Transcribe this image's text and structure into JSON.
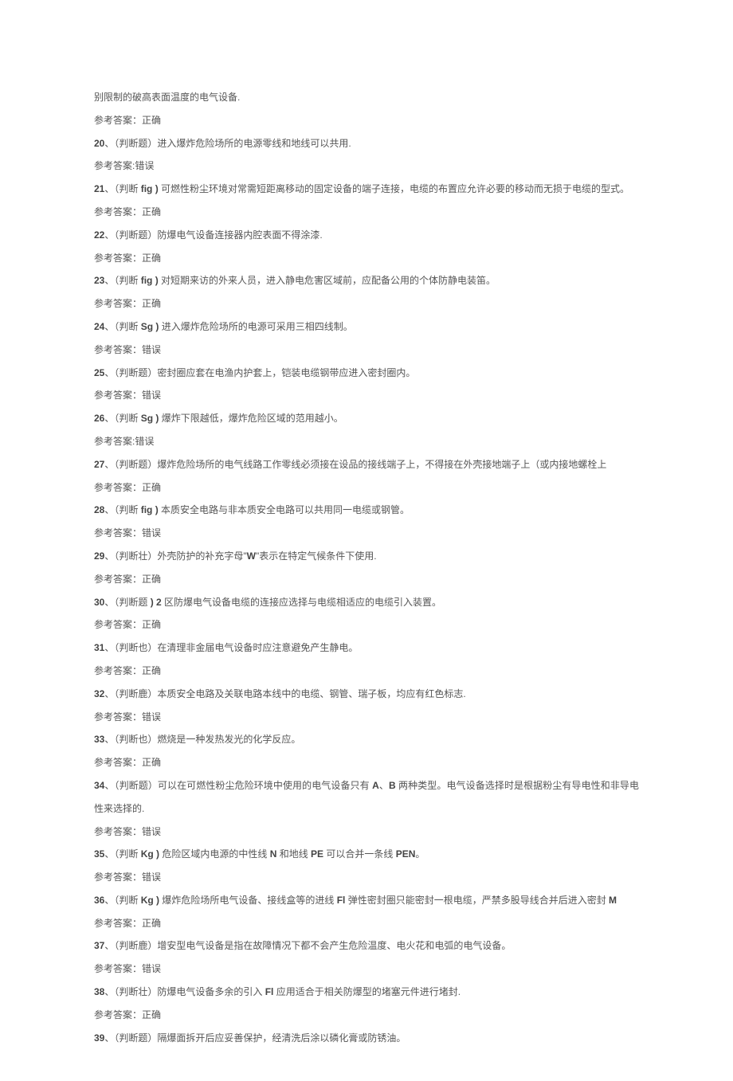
{
  "lines": [
    {
      "text": "别限制的破高表面温度的电气设备."
    },
    {
      "text": "参考答案：正确"
    },
    {
      "spans": [
        {
          "t": "20",
          "b": true
        },
        {
          "t": "、（判断题）进入爆炸危险场所的电源零线和地线可以共用."
        }
      ]
    },
    {
      "text": "参考答案:错误"
    },
    {
      "spans": [
        {
          "t": "21",
          "b": true
        },
        {
          "t": "、（判断 "
        },
        {
          "t": "fig )",
          "b": true
        },
        {
          "t": " 可燃性粉尘环境对常需短距离移动的固定设备的端子连接，电缆的布置应允许必要的移动而无损于电缆的型式。"
        }
      ]
    },
    {
      "text": "参考答案：正确"
    },
    {
      "spans": [
        {
          "t": "22",
          "b": true
        },
        {
          "t": "、（判断题）防爆电气设备连接器内腔表面不得涂漆."
        }
      ]
    },
    {
      "text": "参考答案：正确"
    },
    {
      "spans": [
        {
          "t": "23",
          "b": true
        },
        {
          "t": "、（判断 "
        },
        {
          "t": "fig )",
          "b": true
        },
        {
          "t": " 对短期来访的外来人员，进入静电危害区域前，应配备公用的个体防静电装笛。"
        }
      ]
    },
    {
      "text": "参考答案：正确"
    },
    {
      "spans": [
        {
          "t": "24",
          "b": true
        },
        {
          "t": "、（判断 "
        },
        {
          "t": "Sg )",
          "b": true
        },
        {
          "t": " 进入爆炸危险场所的电源可采用三相四线制。"
        }
      ]
    },
    {
      "text": "参考答案：错误"
    },
    {
      "spans": [
        {
          "t": "25",
          "b": true
        },
        {
          "t": "、（判断题）密封圈应套在电渔内护套上，铠装电缆钢带应进入密封圈内。"
        }
      ]
    },
    {
      "text": "参考答案：错误"
    },
    {
      "spans": [
        {
          "t": "26",
          "b": true
        },
        {
          "t": "、（判断 "
        },
        {
          "t": "Sg )",
          "b": true
        },
        {
          "t": " 爆炸下限越低，爆炸危险区域的范用越小。"
        }
      ]
    },
    {
      "text": "参考答案:错误"
    },
    {
      "spans": [
        {
          "t": "27",
          "b": true
        },
        {
          "t": "、（判断题）爆炸危险场所的电气线路工作零线必须接在设品的接线端子上，不得接在外壳接地端子上（或内接地螺栓上"
        }
      ]
    },
    {
      "text": "参考答案：正确"
    },
    {
      "spans": [
        {
          "t": "28",
          "b": true
        },
        {
          "t": "、（判断 "
        },
        {
          "t": "fig )",
          "b": true
        },
        {
          "t": " 本质安全电路与非本质安全电路可以共用同一电缆或钢管。"
        }
      ]
    },
    {
      "text": "参考答案：错误"
    },
    {
      "spans": [
        {
          "t": "29",
          "b": true
        },
        {
          "t": "、（判断壮）外壳防护的补充字母\""
        },
        {
          "t": "W",
          "b": true
        },
        {
          "t": "\"表示在特定气候条件下使用."
        }
      ]
    },
    {
      "text": "参考答案：正确"
    },
    {
      "spans": [
        {
          "t": "30",
          "b": true
        },
        {
          "t": "、（判断题 "
        },
        {
          "t": ") 2",
          "b": true
        },
        {
          "t": " 区防爆电气设备电缆的连接应选择与电缆相适应的电缆引入装置。"
        }
      ]
    },
    {
      "text": "参考答案：正确"
    },
    {
      "spans": [
        {
          "t": "31",
          "b": true
        },
        {
          "t": "、（判断也）在清理非金届电气设备时应注意避免产生静电。"
        }
      ]
    },
    {
      "text": "参考答案：正确"
    },
    {
      "spans": [
        {
          "t": "32",
          "b": true
        },
        {
          "t": "、（判断鹿）本质安全电路及关联电路本线中的电缆、钢管、瑞子板，均应有红色标志."
        }
      ]
    },
    {
      "text": "参考答案：错误"
    },
    {
      "spans": [
        {
          "t": "33",
          "b": true
        },
        {
          "t": "、（判断也）燃烧是一种发热发光的化学反应。"
        }
      ]
    },
    {
      "text": "参考答案：正确"
    },
    {
      "spans": [
        {
          "t": "34",
          "b": true
        },
        {
          "t": "、（判断题）可以在可燃性粉尘危险环境中使用的电气设备只有 "
        },
        {
          "t": "A",
          "b": true
        },
        {
          "t": "、"
        },
        {
          "t": "B",
          "b": true
        },
        {
          "t": " 两种类型。电气设备选择时是根据粉尘有导电性和非导电性来选择的."
        }
      ]
    },
    {
      "text": "参考答案：错误"
    },
    {
      "spans": [
        {
          "t": "35",
          "b": true
        },
        {
          "t": "、（判断 "
        },
        {
          "t": "Kg )",
          "b": true
        },
        {
          "t": " 危险区域内电源的中性线 "
        },
        {
          "t": "N",
          "b": true
        },
        {
          "t": " 和地线 "
        },
        {
          "t": "PE",
          "b": true
        },
        {
          "t": " 可以合并一条线 "
        },
        {
          "t": "PEN",
          "b": true
        },
        {
          "t": "。"
        }
      ]
    },
    {
      "text": "参考答案：错误"
    },
    {
      "spans": [
        {
          "t": "36",
          "b": true
        },
        {
          "t": "、（判断 "
        },
        {
          "t": "Kg )",
          "b": true
        },
        {
          "t": " 爆炸危险场所电气设备、接线盒等的进线 "
        },
        {
          "t": "Fl",
          "b": true
        },
        {
          "t": " 弹性密封圈只能密封一根电缆，严禁多股导线合并后进入密封 "
        },
        {
          "t": "M",
          "b": true
        }
      ]
    },
    {
      "text": "参考答案：正确"
    },
    {
      "spans": [
        {
          "t": "37",
          "b": true
        },
        {
          "t": "、（判断鹿）增安型电气设备是指在故障情况下都不会产生危险温度、电火花和电弧的电气设备。"
        }
      ]
    },
    {
      "text": "参考答案：错误"
    },
    {
      "spans": [
        {
          "t": "38",
          "b": true
        },
        {
          "t": "、（判断壮）防爆电气设备多余的引入 "
        },
        {
          "t": "Fl",
          "b": true
        },
        {
          "t": " 应用适合于相关防爆型的堵塞元件进行堵封."
        }
      ]
    },
    {
      "text": "参考答案：正确"
    },
    {
      "spans": [
        {
          "t": "39",
          "b": true
        },
        {
          "t": "、（判断题）隔爆面拆开后应妥善保护，经清洗后涂以磷化膏或防锈油。"
        }
      ]
    }
  ]
}
